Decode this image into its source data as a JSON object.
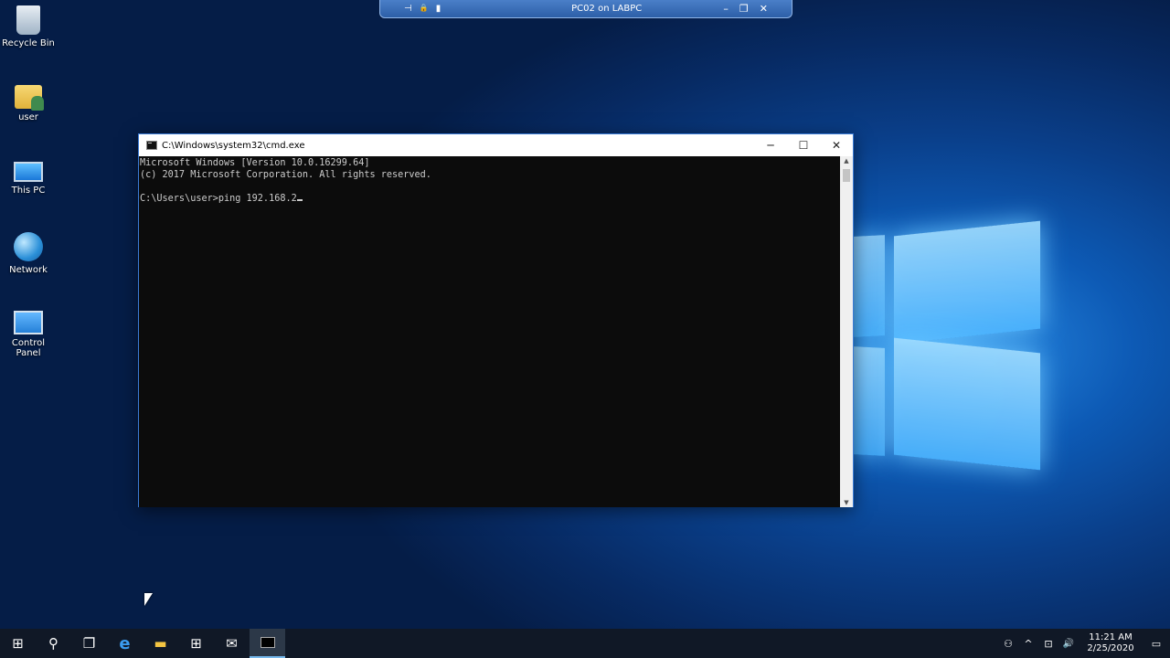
{
  "desktop": {
    "icons": [
      {
        "label": "Recycle Bin"
      },
      {
        "label": "user"
      },
      {
        "label": "This PC"
      },
      {
        "label": "Network"
      },
      {
        "label": "Control Panel"
      }
    ]
  },
  "remote_bar": {
    "title": "PC02 on LABPC",
    "pin": "⊣",
    "lock": "🔒",
    "signal": "▮",
    "minimize": "–",
    "restore": "❐",
    "close": "✕"
  },
  "cmd_window": {
    "title": "C:\\Windows\\system32\\cmd.exe",
    "minimize": "─",
    "maximize": "☐",
    "close": "✕",
    "console_lines": [
      "Microsoft Windows [Version 10.0.16299.64]",
      "(c) 2017 Microsoft Corporation. All rights reserved.",
      "",
      "C:\\Users\\user>ping 192.168.2"
    ],
    "scroll_up": "▲",
    "scroll_down": "▼"
  },
  "taskbar": {
    "start": "⊞",
    "search": "⚲",
    "task_view": "❐",
    "edge": "e",
    "explorer": "▬",
    "store": "⊞",
    "mail": "✉",
    "tray": {
      "people": "⚇",
      "chevron": "^",
      "network": "⊡",
      "volume": "🔊",
      "time": "11:21 AM",
      "date": "2/25/2020",
      "notifications": "▭"
    }
  },
  "colors": {
    "accent": "#76b9ed",
    "console_bg": "#0c0c0c",
    "console_fg": "#cccccc"
  }
}
